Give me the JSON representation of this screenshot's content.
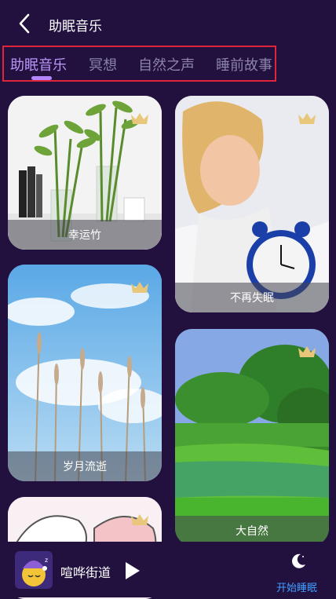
{
  "header": {
    "title": "助眠音乐"
  },
  "tabs": [
    {
      "label": "助眠音乐",
      "active": true
    },
    {
      "label": "冥想",
      "active": false
    },
    {
      "label": "自然之声",
      "active": false
    },
    {
      "label": "睡前故事",
      "active": false
    }
  ],
  "cards": [
    {
      "label": "幸运竹",
      "premium": true
    },
    {
      "label": "不再失眠",
      "premium": true
    },
    {
      "label": "岁月流逝",
      "premium": true
    },
    {
      "label": "大自然",
      "premium": true
    },
    {
      "label": "",
      "premium": true
    }
  ],
  "player": {
    "song": "喧哗街道",
    "sleep_label": "开始睡眠"
  },
  "colors": {
    "background": "#22103f",
    "accent": "#b584ff",
    "crown": "#e8c77a",
    "sleep": "#3fa0ff"
  }
}
